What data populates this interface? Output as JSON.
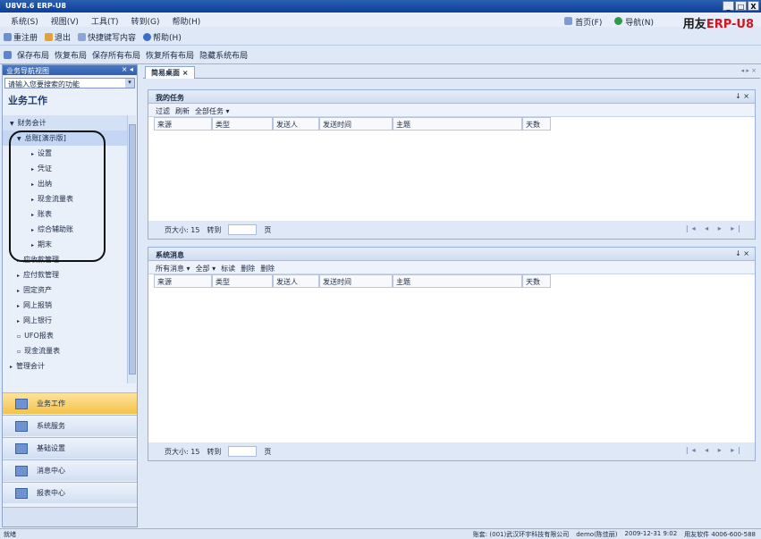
{
  "window": {
    "title": "U8V8.6 ERP-U8",
    "controls": [
      "_",
      "□",
      "X"
    ]
  },
  "menu": {
    "items": [
      "系统(S)",
      "视图(V)",
      "工具(T)",
      "转到(G)",
      "帮助(H)"
    ]
  },
  "top_right": {
    "items": [
      "首页(F)",
      "导航(N)"
    ],
    "logo_text": "用友",
    "logo_red": "ERP-U8"
  },
  "toolbar1": {
    "items": [
      "重注册",
      "退出",
      "快捷键写内容",
      "帮助(H)"
    ]
  },
  "toolbar2": {
    "items": [
      "保存布局",
      "恢复布局",
      "保存所有布局",
      "恢复所有布局",
      "隐藏系统布局"
    ]
  },
  "nav": {
    "header": "业务导航视图",
    "search_placeholder": "请输入您要搜索的功能",
    "section_title": "业务工作",
    "tree": [
      {
        "label": "财务会计",
        "level": 1,
        "expanded": true,
        "hdr": true
      },
      {
        "label": "总账[演示版]",
        "level": 2,
        "expanded": true,
        "sel": true
      },
      {
        "label": "设置",
        "level": 3
      },
      {
        "label": "凭证",
        "level": 3
      },
      {
        "label": "出纳",
        "level": 3
      },
      {
        "label": "现金流量表",
        "level": 3
      },
      {
        "label": "账表",
        "level": 3
      },
      {
        "label": "综合辅助账",
        "level": 3
      },
      {
        "label": "期末",
        "level": 3
      },
      {
        "label": "应收款管理",
        "level": 2
      },
      {
        "label": "应付款管理",
        "level": 2
      },
      {
        "label": "固定资产",
        "level": 2
      },
      {
        "label": "网上报销",
        "level": 2
      },
      {
        "label": "网上银行",
        "level": 2
      },
      {
        "label": "UFO报表",
        "level": 2
      },
      {
        "label": "现金流量表",
        "level": 2
      },
      {
        "label": "管理会计",
        "level": 1
      }
    ],
    "buttons": [
      "业务工作",
      "系统服务",
      "基础设置",
      "消息中心",
      "报表中心"
    ]
  },
  "tab": {
    "label": "简易桌面"
  },
  "panel1": {
    "title": "我的任务",
    "tools": [
      "过滤",
      "刷新",
      "全部任务 ▾"
    ],
    "columns": [
      "来源",
      "类型",
      "发送人",
      "发送时间",
      "主题",
      "天数"
    ],
    "page_size_label": "页大小: 15",
    "page_label": "转到",
    "page_unit": "页"
  },
  "panel2": {
    "title": "系统消息",
    "tools": [
      "所有消息 ▾",
      "全部 ▾",
      "标读",
      "删除",
      "删除"
    ],
    "columns": [
      "来源",
      "类型",
      "发送人",
      "发送时间",
      "主题",
      "天数"
    ],
    "page_size_label": "页大小: 15",
    "page_label": "转到",
    "page_unit": "页"
  },
  "status": {
    "left": "就绪",
    "items": [
      "账套: (001)武汉环宇科技有限公司",
      "demo(陈佳丽)",
      "2009-12-31 9:02",
      "用友软件 4006-600-588"
    ]
  }
}
